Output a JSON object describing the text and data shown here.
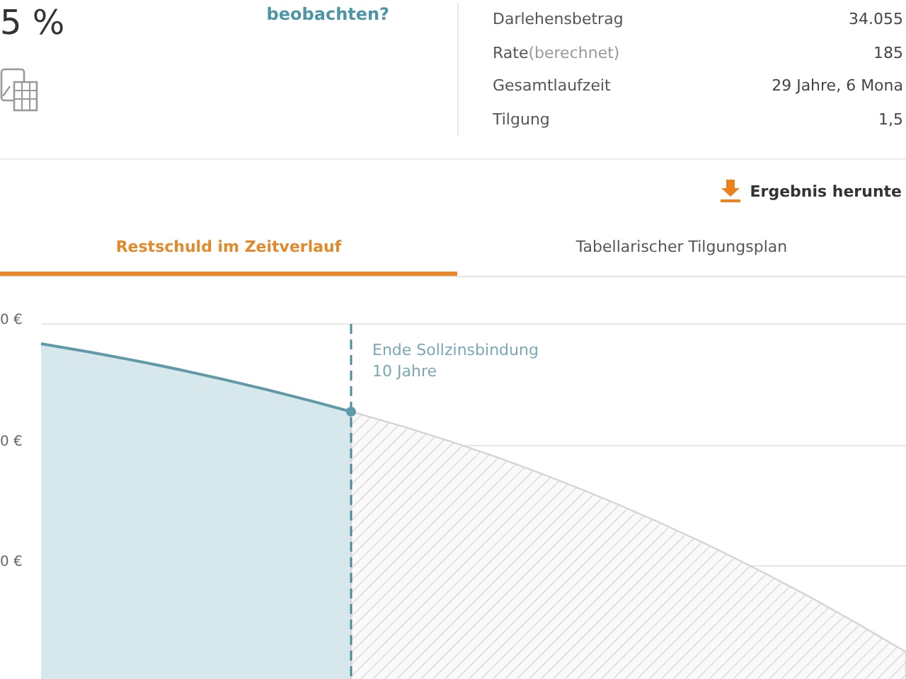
{
  "rate": {
    "value": "5 %",
    "link": "beobachten?"
  },
  "summary": [
    {
      "label": "Darlehensbetrag",
      "value": "34.055"
    },
    {
      "label": "Rate",
      "note": "(berechnet)",
      "value": "185"
    },
    {
      "label": "Gesamtlaufzeit",
      "value": "29 Jahre, 6 Mona"
    },
    {
      "label": "Tilgung",
      "value": "1,5"
    }
  ],
  "download": {
    "label": "Ergebnis herunte"
  },
  "tabs": [
    {
      "label": "Restschuld im Zeitverlauf",
      "selected": true
    },
    {
      "label": "Tabellarischer Tilgungsplan",
      "selected": false
    }
  ],
  "chart": {
    "y_labels": [
      "0 €",
      "0 €",
      "0 €"
    ],
    "annotation": [
      "Ende Sollzinsbindung",
      "10 Jahre"
    ]
  }
}
